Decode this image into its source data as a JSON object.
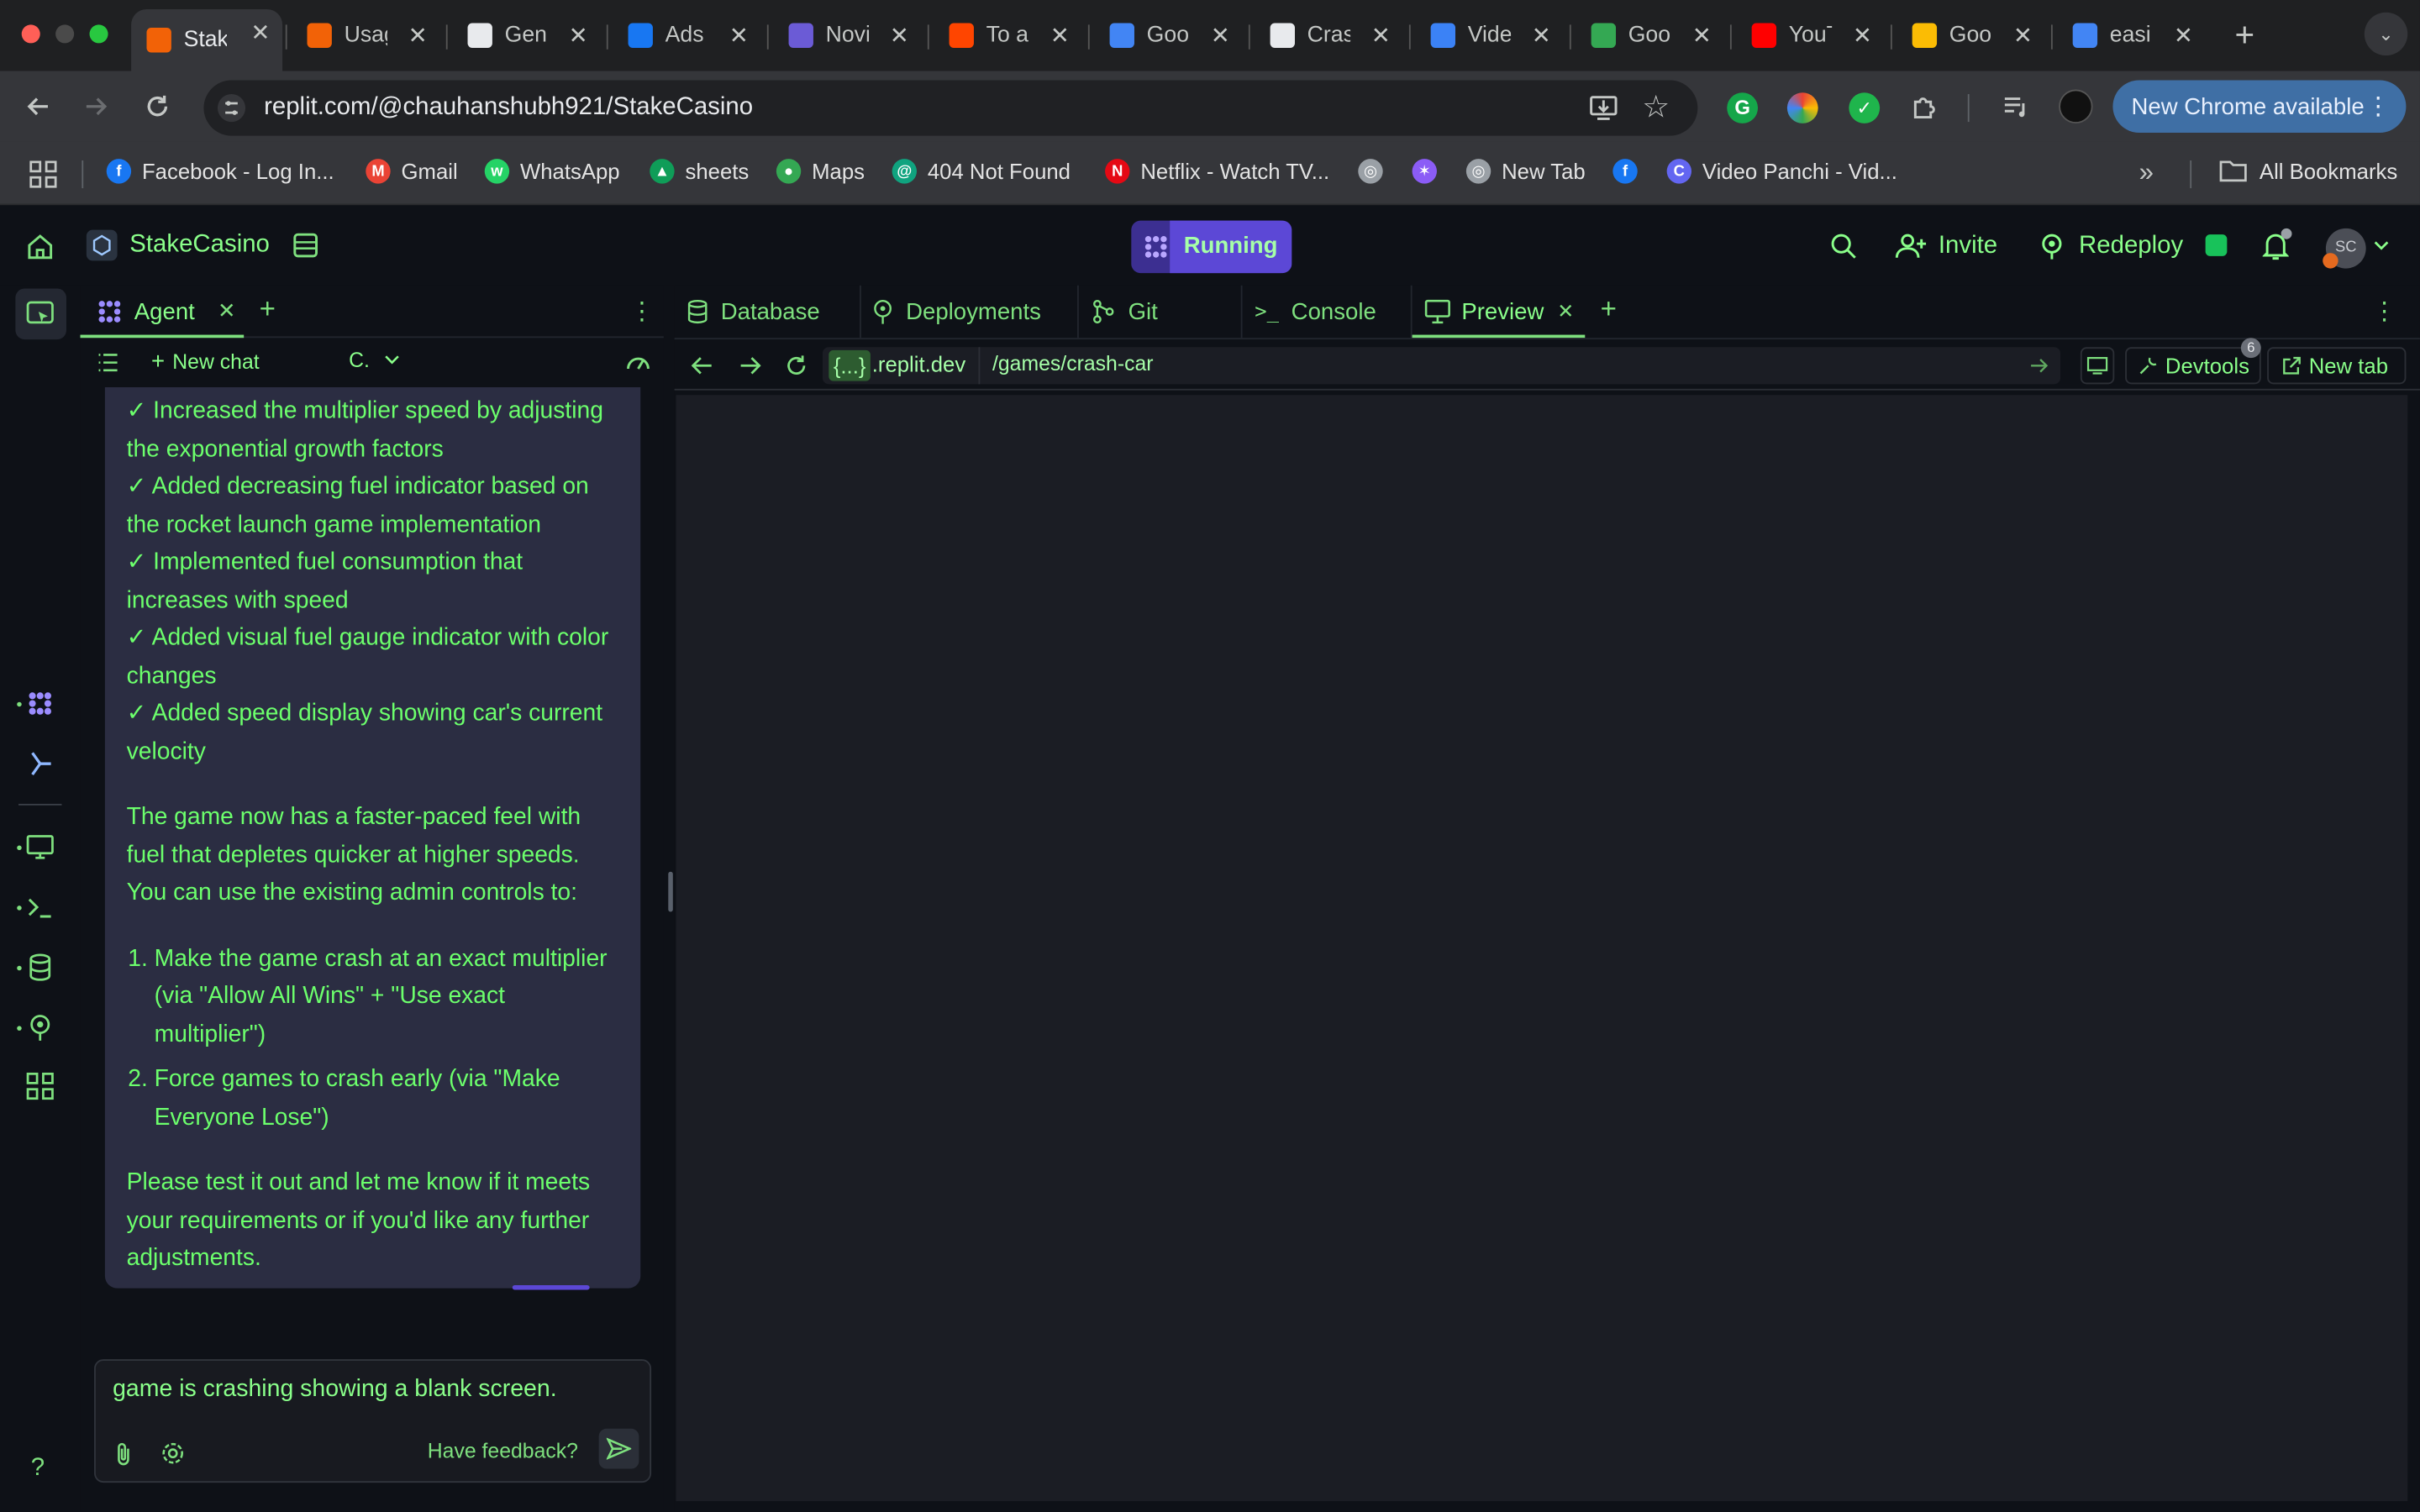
{
  "browser": {
    "tabs": [
      {
        "title": "Stak",
        "icon": "replit-icon",
        "color": "#f26207"
      },
      {
        "title": "Usag",
        "icon": "replit-icon",
        "color": "#f26207"
      },
      {
        "title": "Gen",
        "icon": "github-icon",
        "color": "#ffffff"
      },
      {
        "title": "Ads",
        "icon": "meta-icon",
        "color": "#1877f2"
      },
      {
        "title": "Novi",
        "icon": "novi-icon",
        "color": "#6b5bd6"
      },
      {
        "title": "To a",
        "icon": "reddit-icon",
        "color": "#ff4500"
      },
      {
        "title": "Goo",
        "icon": "google-icon",
        "color": "#4285f4"
      },
      {
        "title": "Cras",
        "icon": "openai-icon",
        "color": "#ffffff"
      },
      {
        "title": "Vide",
        "icon": "video-icon",
        "color": "#3b82f6"
      },
      {
        "title": "Goo",
        "icon": "google-play-icon",
        "color": "#34a853"
      },
      {
        "title": "YouT",
        "icon": "youtube-icon",
        "color": "#ff0000"
      },
      {
        "title": "Goo",
        "icon": "google-keep-icon",
        "color": "#fbbc04"
      },
      {
        "title": "easi",
        "icon": "google-icon",
        "color": "#4285f4"
      }
    ],
    "url": "replit.com/@chauhanshubh921/StakeCasino",
    "update_label": "New Chrome available",
    "bookmarks": [
      {
        "label": "Facebook - Log In...",
        "color": "#1877f2",
        "glyph": "f"
      },
      {
        "label": "Gmail",
        "color": "#ea4335",
        "glyph": "M"
      },
      {
        "label": "WhatsApp",
        "color": "#25d366",
        "glyph": "w"
      },
      {
        "label": "sheets",
        "color": "#0f9d58",
        "glyph": "▲"
      },
      {
        "label": "Maps",
        "color": "#34a853",
        "glyph": "●"
      },
      {
        "label": "404 Not Found",
        "color": "#10a37f",
        "glyph": "@"
      },
      {
        "label": "Netflix - Watch TV...",
        "color": "#e50914",
        "glyph": "N"
      },
      {
        "label": "",
        "color": "#9aa0a6",
        "glyph": "◎"
      },
      {
        "label": "",
        "color": "#8b5cf6",
        "glyph": "✶"
      },
      {
        "label": "New Tab",
        "color": "#9aa0a6",
        "glyph": "◎"
      },
      {
        "label": "",
        "color": "#1877f2",
        "glyph": "f"
      },
      {
        "label": "Video Panchi - Vid...",
        "color": "#6366f1",
        "glyph": "C"
      }
    ],
    "all_bookmarks": "All Bookmarks"
  },
  "replit": {
    "project": "StakeCasino",
    "status": "Running",
    "invite": "Invite",
    "redeploy": "Redeploy",
    "avatar": "SC",
    "agent_tab": "Agent",
    "new_chat": "New chat",
    "model": "C.",
    "messages": {
      "checks": [
        "✓ Increased the multiplier speed by adjusting the exponential growth factors",
        "✓ Added decreasing fuel indicator based on the rocket launch game implementation",
        "✓ Implemented fuel consumption that increases with speed",
        "✓ Added visual fuel gauge indicator with color changes",
        "✓ Added speed display showing car's current velocity"
      ],
      "summary": "The game now has a faster-paced feel with fuel that depletes quicker at higher speeds. You can use the existing admin controls to:",
      "steps": [
        "Make the game crash at an exact multiplier (via \"Allow All Wins\" + \"Use exact multiplier\")",
        "Force games to crash early (via \"Make Everyone Lose\")"
      ],
      "closing": "Please test it out and let me know if it meets your requirements or if you'd like any further adjustments."
    },
    "input_text": "game is crashing showing a blank screen.",
    "feedback": "Have feedback?",
    "right_tabs": [
      "Database",
      "Deployments",
      "Git",
      "Console",
      "Preview"
    ],
    "preview": {
      "domain": "{...}.replit.dev",
      "domain_prefix": "{...}",
      "domain_suffix": ".replit.dev",
      "path": "/games/crash-car",
      "devtools": "Devtools",
      "devtools_badge": "6",
      "new_tab": "New tab"
    },
    "help": "?"
  }
}
